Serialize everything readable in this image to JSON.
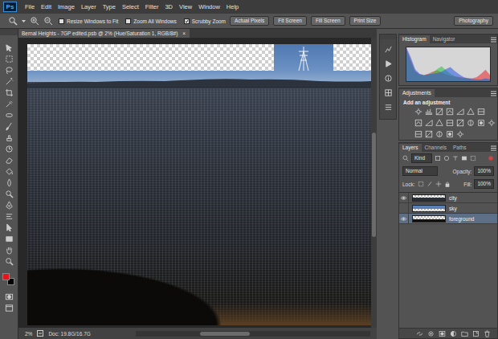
{
  "app": {
    "logo": "Ps"
  },
  "menu": [
    "File",
    "Edit",
    "Image",
    "Layer",
    "Type",
    "Select",
    "Filter",
    "3D",
    "View",
    "Window",
    "Help"
  ],
  "options_bar": {
    "checkboxes": [
      {
        "label": "Resize Windows to Fit",
        "checked": false
      },
      {
        "label": "Zoom All Windows",
        "checked": false
      },
      {
        "label": "Scrubby Zoom",
        "checked": true
      }
    ],
    "buttons": [
      "Actual Pixels",
      "Fit Screen",
      "Fill Screen",
      "Print Size"
    ],
    "workspace": "Photography"
  },
  "document": {
    "tab_title": "Bernal Heights - 7GP edited.psb @ 2% (Hue/Saturation 1, RGB/8#)",
    "close": "×"
  },
  "tools": {
    "swatches": [
      {
        "color": "#e8141b"
      },
      {
        "color": "#000000"
      }
    ]
  },
  "status_bar": {
    "zoom": "2%",
    "doc": "Doc: 19.8G/16.7G"
  },
  "histogram": {
    "tabs": [
      {
        "label": "Histogram",
        "selected": true
      },
      {
        "label": "Navigator",
        "selected": false
      }
    ],
    "series": [
      {
        "color": "#e8262a",
        "values": [
          96,
          62,
          30,
          20,
          18,
          22,
          28,
          32,
          26,
          20,
          16,
          14,
          12,
          10,
          9,
          8,
          12,
          22,
          34,
          18
        ]
      },
      {
        "color": "#22c23a",
        "values": [
          90,
          55,
          28,
          18,
          16,
          20,
          25,
          36,
          44,
          32,
          22,
          14,
          10,
          8,
          6,
          5,
          4,
          4,
          6,
          4
        ]
      },
      {
        "color": "#2a55e8",
        "values": [
          100,
          70,
          35,
          22,
          18,
          20,
          22,
          24,
          28,
          36,
          42,
          30,
          20,
          12,
          8,
          6,
          5,
          5,
          8,
          5
        ]
      }
    ]
  },
  "adjustments": {
    "tabs": [
      {
        "label": "Adjustments",
        "selected": true
      }
    ],
    "hint": "Add an adjustment"
  },
  "layers": {
    "tabs": [
      {
        "label": "Layers",
        "selected": true
      },
      {
        "label": "Channels",
        "selected": false
      },
      {
        "label": "Paths",
        "selected": false
      }
    ],
    "filter": "Kind",
    "blend_mode": "Normal",
    "opacity_label": "Opacity:",
    "opacity": "100%",
    "lock_label": "Lock:",
    "fill_label": "Fill:",
    "fill": "100%",
    "items": [
      {
        "name": "city",
        "visible": true,
        "selected": false
      },
      {
        "name": "sky",
        "visible": false,
        "selected": false
      },
      {
        "name": "foreground",
        "visible": true,
        "selected": true
      }
    ]
  }
}
